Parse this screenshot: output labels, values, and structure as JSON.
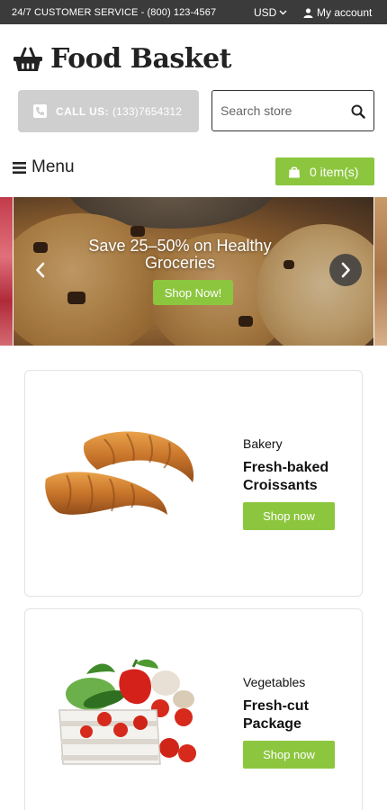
{
  "topbar": {
    "service": "24/7 CUSTOMER SERVICE - (800) 123-4567",
    "currency": "USD",
    "account": "My account"
  },
  "header": {
    "logo_name": "Food Basket"
  },
  "call": {
    "label": "CALL US:",
    "number": "(133)7654312"
  },
  "search": {
    "placeholder": "Search store"
  },
  "nav": {
    "menu_label": "Menu",
    "cart_label": "0 item(s)"
  },
  "slider": {
    "title": "Save 25–50% on Healthy Groceries",
    "button": "Shop Now!"
  },
  "products": [
    {
      "category": "Bakery",
      "name": "Fresh-baked Croissants",
      "button": "Shop now"
    },
    {
      "category": "Vegetables",
      "name": "Fresh-cut Package",
      "button": "Shop now"
    }
  ],
  "colors": {
    "accent": "#8cc63f",
    "topbar": "#3b3b3b",
    "call_bg": "#cfcfcf"
  }
}
